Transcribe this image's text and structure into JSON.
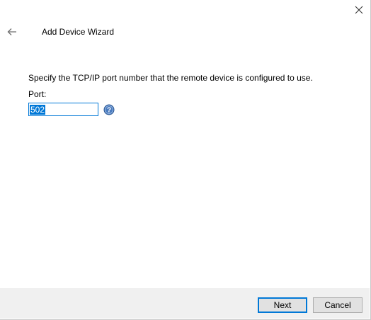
{
  "window": {
    "title": "Add Device Wizard",
    "close_icon": "close-icon",
    "back_icon": "back-arrow-icon"
  },
  "content": {
    "instruction": "Specify the TCP/IP port number that the remote device is configured to use.",
    "port_label": "Port:",
    "port_value": "502",
    "help_icon": "help-icon"
  },
  "footer": {
    "next_label": "Next",
    "cancel_label": "Cancel"
  },
  "colors": {
    "accent": "#0078d7",
    "footer_bg": "#f0f0f0",
    "help_icon": "#4a7bbf"
  }
}
